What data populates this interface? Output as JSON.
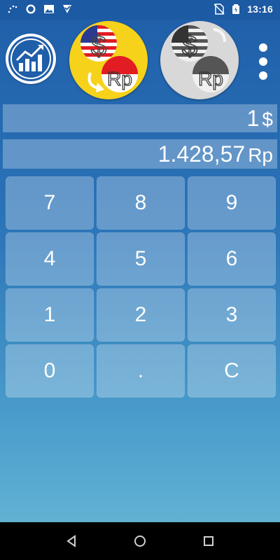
{
  "status_bar": {
    "time": "13:16",
    "icons_left": [
      "loading-dots-icon",
      "circle-icon",
      "image-icon",
      "check-badge-icon"
    ],
    "icons_right": [
      "no-sim-icon",
      "battery-icon"
    ]
  },
  "header": {
    "chart_button_icon": "trend-chart-icon",
    "active_pair": {
      "from": "$",
      "to": "Rp"
    },
    "inactive_pair": {
      "from": "$",
      "to": "Rp"
    },
    "menu_icon": "more-vertical-icon"
  },
  "converter": {
    "input_value": "1",
    "input_unit": "$",
    "output_value": "1.428,57",
    "output_unit": "Rp"
  },
  "keypad": {
    "keys": [
      "7",
      "8",
      "9",
      "4",
      "5",
      "6",
      "1",
      "2",
      "3",
      "0",
      ".",
      "C"
    ]
  },
  "nav": {
    "icons": [
      "back-icon",
      "home-icon",
      "recents-icon"
    ]
  },
  "colors": {
    "accent_yellow": "#f6d21a",
    "flag_red": "#e21c23",
    "flag_blue": "#2b3a8f",
    "background_top": "#1f5ea9",
    "background_bottom": "#6ab9d6"
  }
}
